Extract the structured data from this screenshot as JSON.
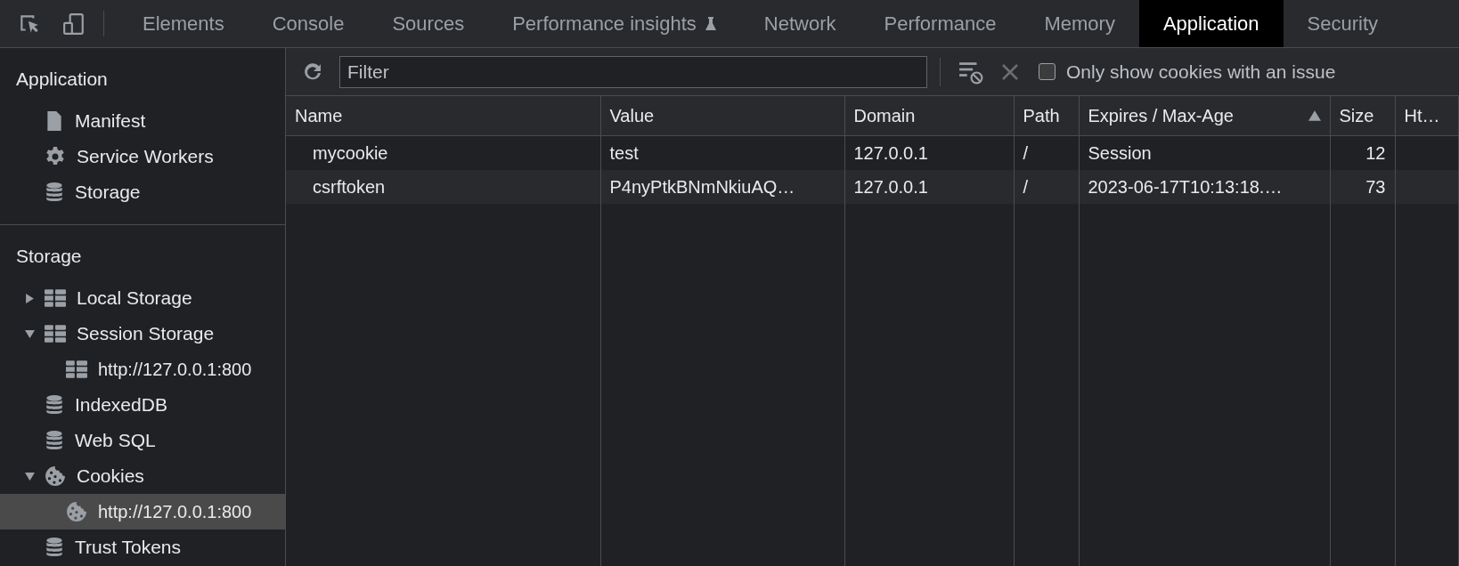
{
  "tabs": [
    {
      "label": "Elements",
      "selected": false,
      "experimental": false
    },
    {
      "label": "Console",
      "selected": false,
      "experimental": false
    },
    {
      "label": "Sources",
      "selected": false,
      "experimental": false
    },
    {
      "label": "Performance insights",
      "selected": false,
      "experimental": true
    },
    {
      "label": "Network",
      "selected": false,
      "experimental": false
    },
    {
      "label": "Performance",
      "selected": false,
      "experimental": false
    },
    {
      "label": "Memory",
      "selected": false,
      "experimental": false
    },
    {
      "label": "Application",
      "selected": true,
      "experimental": false
    },
    {
      "label": "Security",
      "selected": false,
      "experimental": false
    }
  ],
  "sidebar": {
    "sections": [
      {
        "title": "Application",
        "items": [
          {
            "label": "Manifest",
            "kind": "file",
            "selected": false
          },
          {
            "label": "Service Workers",
            "kind": "gear",
            "selected": false
          },
          {
            "label": "Storage",
            "kind": "database",
            "selected": false
          }
        ]
      },
      {
        "title": "Storage",
        "items": [
          {
            "label": "Local Storage",
            "kind": "grid",
            "selected": false,
            "expanded": false
          },
          {
            "label": "Session Storage",
            "kind": "grid",
            "selected": false,
            "expanded": true,
            "children": [
              {
                "label": "http://127.0.0.1:800",
                "kind": "grid",
                "selected": false
              }
            ]
          },
          {
            "label": "IndexedDB",
            "kind": "database",
            "selected": false
          },
          {
            "label": "Web SQL",
            "kind": "database",
            "selected": false
          },
          {
            "label": "Cookies",
            "kind": "cookie",
            "selected": false,
            "expanded": true,
            "children": [
              {
                "label": "http://127.0.0.1:800",
                "kind": "cookie",
                "selected": true
              }
            ]
          },
          {
            "label": "Trust Tokens",
            "kind": "database",
            "selected": false
          }
        ]
      }
    ]
  },
  "toolbar": {
    "filter": {
      "placeholder": "Filter"
    },
    "issue_checkbox": {
      "label": "Only show cookies with an issue",
      "checked": false
    }
  },
  "table": {
    "columns": [
      {
        "label": "Name",
        "sorted": false,
        "kind": "text"
      },
      {
        "label": "Value",
        "sorted": false,
        "kind": "text"
      },
      {
        "label": "Domain",
        "sorted": false,
        "kind": "text"
      },
      {
        "label": "Path",
        "sorted": false,
        "kind": "text"
      },
      {
        "label": "Expires / Max-Age",
        "sorted": true,
        "kind": "text"
      },
      {
        "label": "Size",
        "sorted": false,
        "kind": "number"
      },
      {
        "label": "Ht…",
        "sorted": false,
        "kind": "text"
      }
    ],
    "rows": [
      [
        "mycookie",
        "test",
        "127.0.0.1",
        "/",
        "Session",
        "12",
        ""
      ],
      [
        "csrftoken",
        "P4nyPtkBNmNkiuAQ…",
        "127.0.0.1",
        "/",
        "2023-06-17T10:13:18.…",
        "73",
        ""
      ]
    ]
  }
}
